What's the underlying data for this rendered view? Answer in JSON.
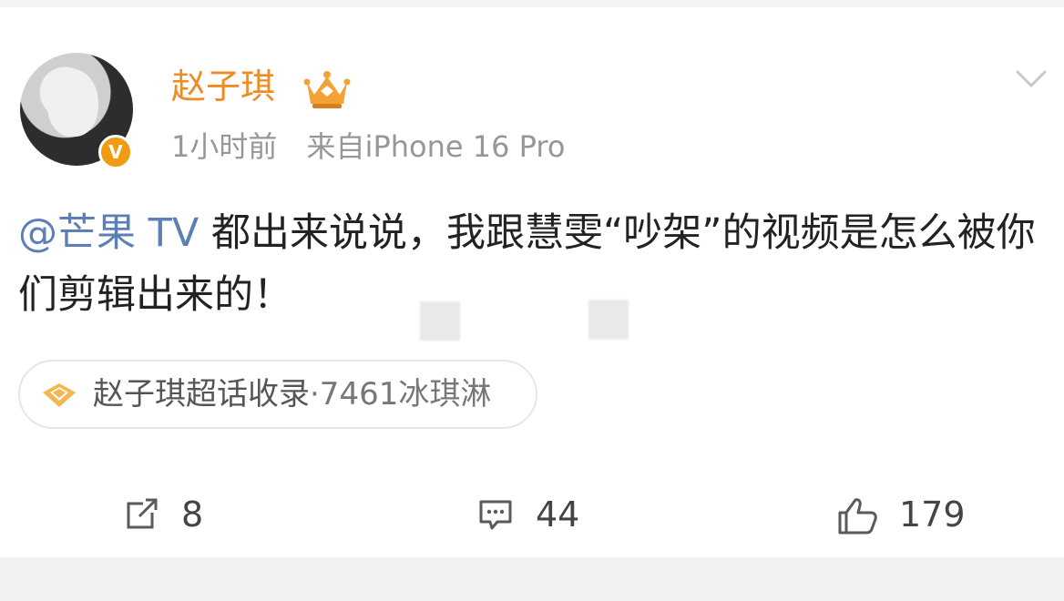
{
  "post": {
    "author": {
      "name": "赵子琪",
      "verified_mark": "V"
    },
    "meta": {
      "time": "1小时前",
      "source": "来自iPhone 16 Pro"
    },
    "content": {
      "mention": "@芒果 TV",
      "text": " 都出来说说，我跟慧雯“吵架”的视频是怎么被你们剪辑出来的！"
    },
    "tag_chip": {
      "text_main": "赵子琪超话收录",
      "text_sep": "·7461冰琪淋"
    },
    "actions": {
      "repost_count": "8",
      "comment_count": "44",
      "like_count": "179"
    }
  },
  "icons": {
    "crown": "crown-icon",
    "verified": "verified-badge-icon",
    "chevron": "chevron-down-icon",
    "repost": "repost-icon",
    "comment": "comment-icon",
    "like": "like-icon",
    "diamond": "diamond-icon"
  },
  "colors": {
    "name": "#f08a24",
    "meta": "#979797",
    "mention": "#5d7fb5",
    "text": "#222222",
    "badge": "#f29a11"
  }
}
